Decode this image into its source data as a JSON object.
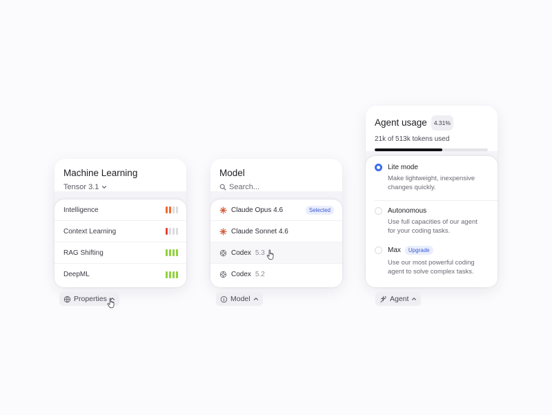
{
  "colors": {
    "accent": "#3a6cf0",
    "bar_red": "#e8423a",
    "bar_orange": "#ee6a2e",
    "bar_green": "#8fd33c",
    "bar_empty": "#dcdbe0",
    "claude": "#d4593a"
  },
  "ml_panel": {
    "title": "Machine Learning",
    "version": "Tensor 3.1",
    "version_icon": "chevron-down-icon",
    "properties": [
      {
        "label": "Intelligence",
        "level": 2,
        "color": "#ee6a2e"
      },
      {
        "label": "Context Learning",
        "level": 1,
        "color": "#e8423a"
      },
      {
        "label": "RAG Shifting",
        "level": 4,
        "color": "#8fd33c"
      },
      {
        "label": "DeepML",
        "level": 4,
        "color": "#8fd33c"
      }
    ],
    "trigger_label": "Properties",
    "trigger_icon": "globe-icon"
  },
  "model_panel": {
    "title": "Model",
    "search_placeholder": "Search...",
    "models": [
      {
        "name": "Claude Opus 4.6",
        "version": "",
        "icon": "claude-icon",
        "badge": "Selected"
      },
      {
        "name": "Claude Sonnet 4.6",
        "version": "",
        "icon": "claude-icon",
        "badge": ""
      },
      {
        "name": "Codex",
        "version": "5.3",
        "icon": "openai-icon",
        "badge": ""
      },
      {
        "name": "Codex",
        "version": "5.2",
        "icon": "openai-icon",
        "badge": ""
      }
    ],
    "trigger_label": "Model",
    "trigger_icon": "info-icon"
  },
  "agent_panel": {
    "title": "Agent usage",
    "percent": "4.31%",
    "usage_text": "21k of 513k tokens used",
    "usage_fraction": 0.6,
    "options": [
      {
        "title": "Lite mode",
        "badge": "",
        "desc1": "Make lightweight, inexpensive",
        "desc2": "changes quickly.",
        "selected": true
      },
      {
        "title": "Autonomous",
        "badge": "",
        "desc1": "Use full capacities of our agent",
        "desc2": "for your coding tasks.",
        "selected": false
      },
      {
        "title": "Max",
        "badge": "Upgrade",
        "desc1": "Use our most powerful coding",
        "desc2": "agent to solve complex tasks.",
        "selected": false
      }
    ],
    "trigger_label": "Agent",
    "trigger_icon": "agent-icon"
  }
}
